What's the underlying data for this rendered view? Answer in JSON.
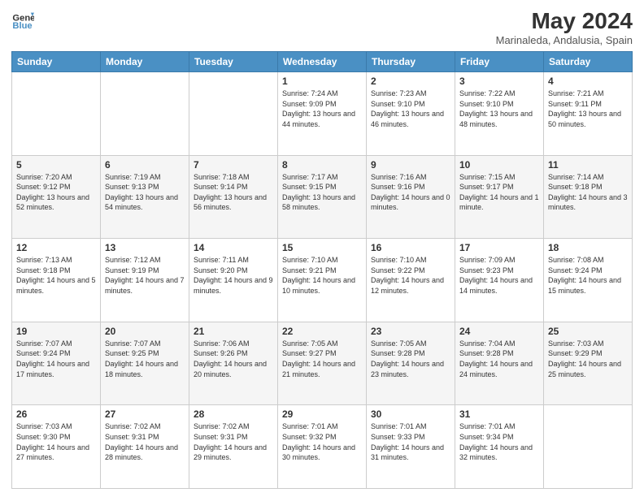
{
  "header": {
    "logo_general": "General",
    "logo_blue": "Blue",
    "title": "May 2024",
    "subtitle": "Marinaleda, Andalusia, Spain"
  },
  "weekdays": [
    "Sunday",
    "Monday",
    "Tuesday",
    "Wednesday",
    "Thursday",
    "Friday",
    "Saturday"
  ],
  "weeks": [
    [
      {
        "day": "",
        "sunrise": "",
        "sunset": "",
        "daylight": ""
      },
      {
        "day": "",
        "sunrise": "",
        "sunset": "",
        "daylight": ""
      },
      {
        "day": "",
        "sunrise": "",
        "sunset": "",
        "daylight": ""
      },
      {
        "day": "1",
        "sunrise": "Sunrise: 7:24 AM",
        "sunset": "Sunset: 9:09 PM",
        "daylight": "Daylight: 13 hours and 44 minutes."
      },
      {
        "day": "2",
        "sunrise": "Sunrise: 7:23 AM",
        "sunset": "Sunset: 9:10 PM",
        "daylight": "Daylight: 13 hours and 46 minutes."
      },
      {
        "day": "3",
        "sunrise": "Sunrise: 7:22 AM",
        "sunset": "Sunset: 9:10 PM",
        "daylight": "Daylight: 13 hours and 48 minutes."
      },
      {
        "day": "4",
        "sunrise": "Sunrise: 7:21 AM",
        "sunset": "Sunset: 9:11 PM",
        "daylight": "Daylight: 13 hours and 50 minutes."
      }
    ],
    [
      {
        "day": "5",
        "sunrise": "Sunrise: 7:20 AM",
        "sunset": "Sunset: 9:12 PM",
        "daylight": "Daylight: 13 hours and 52 minutes."
      },
      {
        "day": "6",
        "sunrise": "Sunrise: 7:19 AM",
        "sunset": "Sunset: 9:13 PM",
        "daylight": "Daylight: 13 hours and 54 minutes."
      },
      {
        "day": "7",
        "sunrise": "Sunrise: 7:18 AM",
        "sunset": "Sunset: 9:14 PM",
        "daylight": "Daylight: 13 hours and 56 minutes."
      },
      {
        "day": "8",
        "sunrise": "Sunrise: 7:17 AM",
        "sunset": "Sunset: 9:15 PM",
        "daylight": "Daylight: 13 hours and 58 minutes."
      },
      {
        "day": "9",
        "sunrise": "Sunrise: 7:16 AM",
        "sunset": "Sunset: 9:16 PM",
        "daylight": "Daylight: 14 hours and 0 minutes."
      },
      {
        "day": "10",
        "sunrise": "Sunrise: 7:15 AM",
        "sunset": "Sunset: 9:17 PM",
        "daylight": "Daylight: 14 hours and 1 minute."
      },
      {
        "day": "11",
        "sunrise": "Sunrise: 7:14 AM",
        "sunset": "Sunset: 9:18 PM",
        "daylight": "Daylight: 14 hours and 3 minutes."
      }
    ],
    [
      {
        "day": "12",
        "sunrise": "Sunrise: 7:13 AM",
        "sunset": "Sunset: 9:18 PM",
        "daylight": "Daylight: 14 hours and 5 minutes."
      },
      {
        "day": "13",
        "sunrise": "Sunrise: 7:12 AM",
        "sunset": "Sunset: 9:19 PM",
        "daylight": "Daylight: 14 hours and 7 minutes."
      },
      {
        "day": "14",
        "sunrise": "Sunrise: 7:11 AM",
        "sunset": "Sunset: 9:20 PM",
        "daylight": "Daylight: 14 hours and 9 minutes."
      },
      {
        "day": "15",
        "sunrise": "Sunrise: 7:10 AM",
        "sunset": "Sunset: 9:21 PM",
        "daylight": "Daylight: 14 hours and 10 minutes."
      },
      {
        "day": "16",
        "sunrise": "Sunrise: 7:10 AM",
        "sunset": "Sunset: 9:22 PM",
        "daylight": "Daylight: 14 hours and 12 minutes."
      },
      {
        "day": "17",
        "sunrise": "Sunrise: 7:09 AM",
        "sunset": "Sunset: 9:23 PM",
        "daylight": "Daylight: 14 hours and 14 minutes."
      },
      {
        "day": "18",
        "sunrise": "Sunrise: 7:08 AM",
        "sunset": "Sunset: 9:24 PM",
        "daylight": "Daylight: 14 hours and 15 minutes."
      }
    ],
    [
      {
        "day": "19",
        "sunrise": "Sunrise: 7:07 AM",
        "sunset": "Sunset: 9:24 PM",
        "daylight": "Daylight: 14 hours and 17 minutes."
      },
      {
        "day": "20",
        "sunrise": "Sunrise: 7:07 AM",
        "sunset": "Sunset: 9:25 PM",
        "daylight": "Daylight: 14 hours and 18 minutes."
      },
      {
        "day": "21",
        "sunrise": "Sunrise: 7:06 AM",
        "sunset": "Sunset: 9:26 PM",
        "daylight": "Daylight: 14 hours and 20 minutes."
      },
      {
        "day": "22",
        "sunrise": "Sunrise: 7:05 AM",
        "sunset": "Sunset: 9:27 PM",
        "daylight": "Daylight: 14 hours and 21 minutes."
      },
      {
        "day": "23",
        "sunrise": "Sunrise: 7:05 AM",
        "sunset": "Sunset: 9:28 PM",
        "daylight": "Daylight: 14 hours and 23 minutes."
      },
      {
        "day": "24",
        "sunrise": "Sunrise: 7:04 AM",
        "sunset": "Sunset: 9:28 PM",
        "daylight": "Daylight: 14 hours and 24 minutes."
      },
      {
        "day": "25",
        "sunrise": "Sunrise: 7:03 AM",
        "sunset": "Sunset: 9:29 PM",
        "daylight": "Daylight: 14 hours and 25 minutes."
      }
    ],
    [
      {
        "day": "26",
        "sunrise": "Sunrise: 7:03 AM",
        "sunset": "Sunset: 9:30 PM",
        "daylight": "Daylight: 14 hours and 27 minutes."
      },
      {
        "day": "27",
        "sunrise": "Sunrise: 7:02 AM",
        "sunset": "Sunset: 9:31 PM",
        "daylight": "Daylight: 14 hours and 28 minutes."
      },
      {
        "day": "28",
        "sunrise": "Sunrise: 7:02 AM",
        "sunset": "Sunset: 9:31 PM",
        "daylight": "Daylight: 14 hours and 29 minutes."
      },
      {
        "day": "29",
        "sunrise": "Sunrise: 7:01 AM",
        "sunset": "Sunset: 9:32 PM",
        "daylight": "Daylight: 14 hours and 30 minutes."
      },
      {
        "day": "30",
        "sunrise": "Sunrise: 7:01 AM",
        "sunset": "Sunset: 9:33 PM",
        "daylight": "Daylight: 14 hours and 31 minutes."
      },
      {
        "day": "31",
        "sunrise": "Sunrise: 7:01 AM",
        "sunset": "Sunset: 9:34 PM",
        "daylight": "Daylight: 14 hours and 32 minutes."
      },
      {
        "day": "",
        "sunrise": "",
        "sunset": "",
        "daylight": ""
      }
    ]
  ]
}
